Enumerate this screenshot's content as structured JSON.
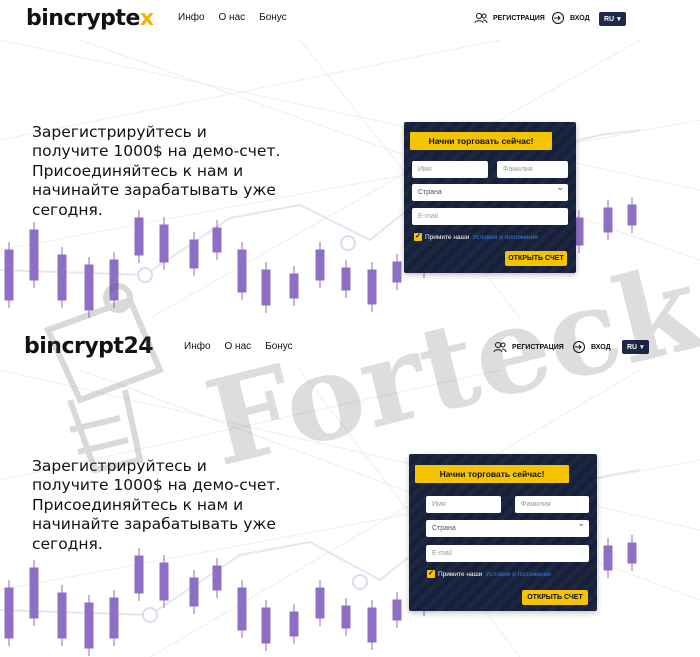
{
  "panels": [
    {
      "logo": {
        "prefix": "bincrypte",
        "accent": "x",
        "suffix": ""
      },
      "nav": {
        "info": "Инфо",
        "about": "О нас",
        "bonus": "Бонус"
      },
      "register": "РЕГИСТРАЦИЯ",
      "login": "ВХОД",
      "lang": "RU",
      "hero": {
        "line1": "Зарегистрируйтесь и",
        "line2": "получите 1000$ на демо-счет.",
        "line3": "Присоединяйтесь к нам и",
        "line4": "начинайте зарабатывать уже",
        "line5": "сегодня."
      },
      "form": {
        "title": "Начни торговать сейчас!",
        "first_name_placeholder": "Имя",
        "last_name_placeholder": "Фамилия",
        "country": "Страна",
        "email_placeholder": "E-mail",
        "accept": "Примите наши",
        "terms": "Условия и положения",
        "submit": "ОТКРЫТЬ СЧЕТ"
      }
    },
    {
      "logo": {
        "prefix": "bincrypt24",
        "accent": "",
        "suffix": ""
      },
      "nav": {
        "info": "Инфо",
        "about": "О нас",
        "bonus": "Бонус"
      },
      "register": "РЕГИСТРАЦИЯ",
      "login": "ВХОД",
      "lang": "RU",
      "hero": {
        "line1": "Зарегистрируйтесь и",
        "line2": "получите 1000$ на демо-счет.",
        "line3": "Присоединяйтесь к нам и",
        "line4": "начинайте зарабатывать уже",
        "line5": "сегодня."
      },
      "form": {
        "title": "Начни торговать сейчас!",
        "first_name_placeholder": "Имя",
        "last_name_placeholder": "Фамилия",
        "country": "Страна",
        "email_placeholder": "E-mail",
        "accept": "Примите наши",
        "terms": "Условия и положения",
        "submit": "ОТКРЫТЬ СЧЕТ"
      }
    }
  ],
  "watermark": "Forteck",
  "colors": {
    "accent": "#f5c400",
    "form_bg": "#16203a",
    "candle": "#8e6fc4",
    "lang_bg": "#1d2a4a",
    "link": "#3b7dde"
  }
}
